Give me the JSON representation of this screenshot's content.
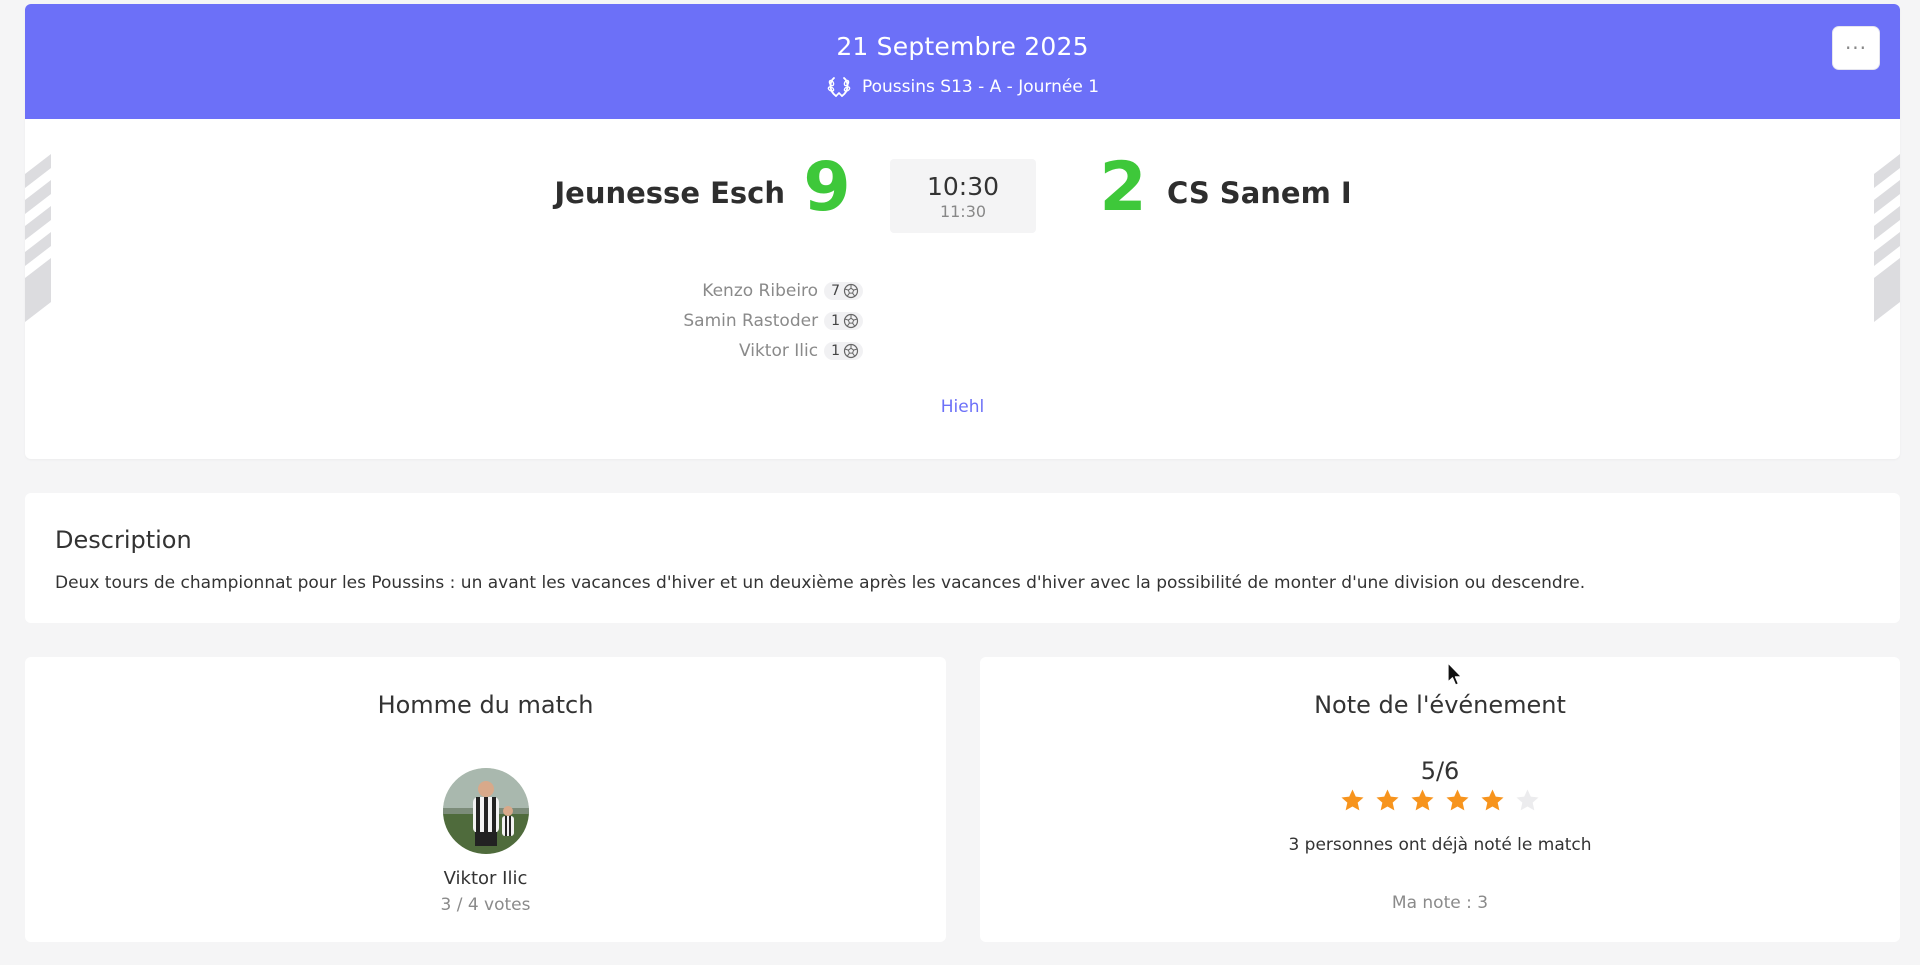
{
  "header": {
    "date": "21 Septembre 2025",
    "competition": "Poussins S13 - A - Journée 1",
    "menu_label": "···",
    "accent_color": "#6c70f8"
  },
  "match": {
    "home_team": "Jeunesse Esch",
    "home_score": "9",
    "away_team": "CS Sanem I",
    "away_score": "2",
    "start_time": "10:30",
    "end_time": "11:30",
    "score_color": "#3ec83a",
    "venue": "Hiehl"
  },
  "scorers": [
    {
      "name": "Kenzo Ribeiro",
      "goals": "7"
    },
    {
      "name": "Samin Rastoder",
      "goals": "1"
    },
    {
      "name": "Viktor Ilic",
      "goals": "1"
    }
  ],
  "description": {
    "title": "Description",
    "text": "Deux tours de championnat pour les Poussins : un avant les vacances d'hiver et un deuxième après les vacances d'hiver avec la possibilité de monter d'une division ou descendre."
  },
  "man_of_the_match": {
    "title": "Homme du match",
    "player": "Viktor Ilic",
    "votes": "3 / 4 votes"
  },
  "rating": {
    "title": "Note de l'événement",
    "score": "5/6",
    "filled_stars": 5,
    "total_stars": 6,
    "count_text": "3 personnes ont déjà noté le match",
    "my_rating": "Ma note : 3",
    "star_color": "#f7941d"
  }
}
